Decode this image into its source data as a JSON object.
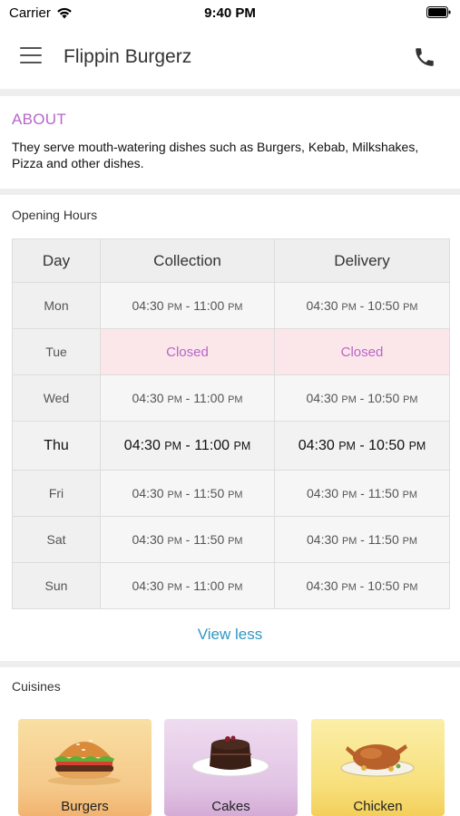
{
  "status_bar": {
    "carrier": "Carrier",
    "time": "9:40 PM"
  },
  "header": {
    "title": "Flippin Burgerz",
    "menu_icon": "hamburger-menu-icon",
    "phone_icon": "phone-icon"
  },
  "about": {
    "label": "ABOUT",
    "text": "They serve mouth-watering dishes such as Burgers, Kebab, Milkshakes, Pizza and other dishes."
  },
  "opening_hours": {
    "label": "Opening Hours",
    "columns": [
      "Day",
      "Collection",
      "Delivery"
    ],
    "rows": [
      {
        "day": "Mon",
        "collection": "04:30 PM - 11:00 PM",
        "delivery": "04:30 PM - 10:50 PM"
      },
      {
        "day": "Tue",
        "collection": "Closed",
        "delivery": "Closed"
      },
      {
        "day": "Wed",
        "collection": "04:30 PM - 11:00 PM",
        "delivery": "04:30 PM - 10:50 PM"
      },
      {
        "day": "Thu",
        "collection": "04:30 PM - 11:00 PM",
        "delivery": "04:30 PM - 10:50 PM"
      },
      {
        "day": "Fri",
        "collection": "04:30 PM - 11:50 PM",
        "delivery": "04:30 PM - 11:50 PM"
      },
      {
        "day": "Sat",
        "collection": "04:30 PM - 11:50 PM",
        "delivery": "04:30 PM - 11:50 PM"
      },
      {
        "day": "Sun",
        "collection": "04:30 PM - 11:00 PM",
        "delivery": "04:30 PM - 10:50 PM"
      }
    ],
    "view_less": "View less"
  },
  "cuisines": {
    "label": "Cuisines",
    "items": [
      {
        "name": "Burgers",
        "image": "burger-image"
      },
      {
        "name": "Cakes",
        "image": "cake-image"
      },
      {
        "name": "Chicken",
        "image": "roast-chicken-image"
      }
    ]
  },
  "colors": {
    "accent": "#b667c9",
    "link": "#2f97c1",
    "closed_bg": "#fbe6ea"
  }
}
